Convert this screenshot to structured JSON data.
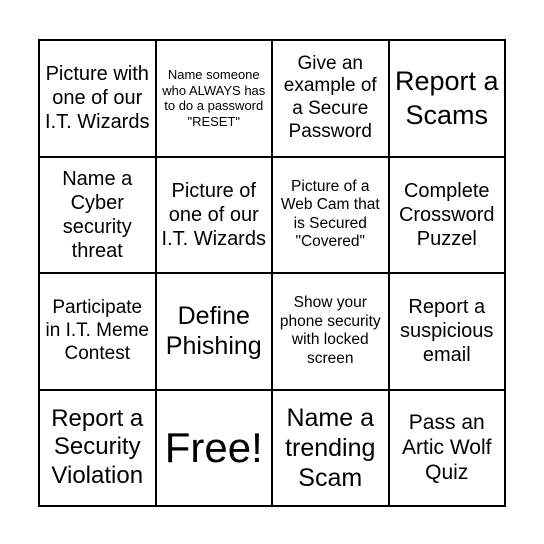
{
  "cells": [
    "Picture with one of our I.T. Wizards",
    "Name someone who ALWAYS has to do a password \"RESET\"",
    "Give an example of a Secure Password",
    "Report a Scams",
    "Name a Cyber security threat",
    "Picture of one of our I.T. Wizards",
    "Picture of a Web Cam that is Secured \"Covered\"",
    "Complete Crossword Puzzel",
    "Participate in I.T. Meme Contest",
    "Define Phishing",
    "Show your phone security with locked screen",
    "Report a suspicious email",
    "Report a Security Violation",
    "Free!",
    "Name a trending Scam",
    "Pass an Artic Wolf Quiz"
  ]
}
